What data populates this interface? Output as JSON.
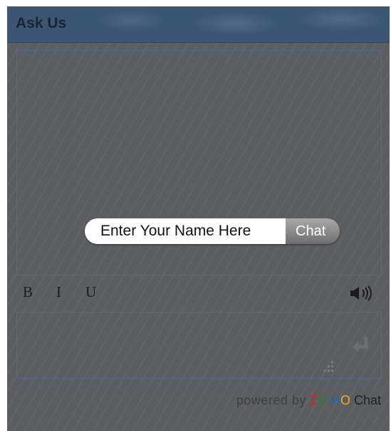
{
  "widget": {
    "title": "Ask Us"
  },
  "name_form": {
    "placeholder": "Enter Your Name Here",
    "chat_button_label": "Chat"
  },
  "toolbar": {
    "bold_label": "B",
    "italic_label": "I",
    "underline_label": "U",
    "sound_icon": "speaker-icon"
  },
  "message_area": {
    "send_icon": "enter-arrow-icon",
    "resize_icon": "resize-grip-icon"
  },
  "footer": {
    "powered_by": "powered by",
    "brand_letters": [
      "Z",
      "O",
      "H",
      "O"
    ],
    "brand_product": "Chat"
  },
  "colors": {
    "brand_z": "#c62828",
    "brand_o1": "#2e7d32",
    "brand_h": "#1565c0",
    "brand_o2": "#f9a825"
  }
}
